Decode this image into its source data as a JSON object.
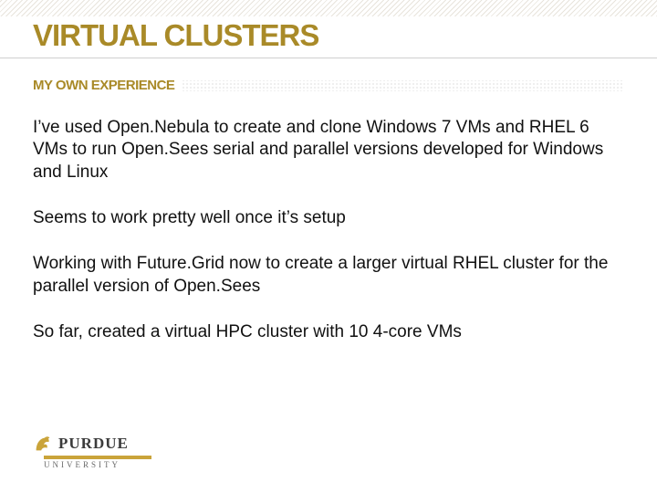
{
  "title": "VIRTUAL CLUSTERS",
  "subtitle": "MY OWN EXPERIENCE",
  "paragraphs": [
    "I’ve used Open.Nebula to create and clone Windows 7 VMs and RHEL 6 VMs to run Open.Sees serial and parallel versions developed for Windows and Linux",
    "Seems to work pretty well once it’s setup",
    "Working with Future.Grid now to create a larger virtual RHEL cluster for the parallel version of Open.Sees",
    "So far, created a virtual HPC cluster with 10 4-core VMs"
  ],
  "logo": {
    "name": "PURDUE",
    "sub": "UNIVERSITY"
  }
}
